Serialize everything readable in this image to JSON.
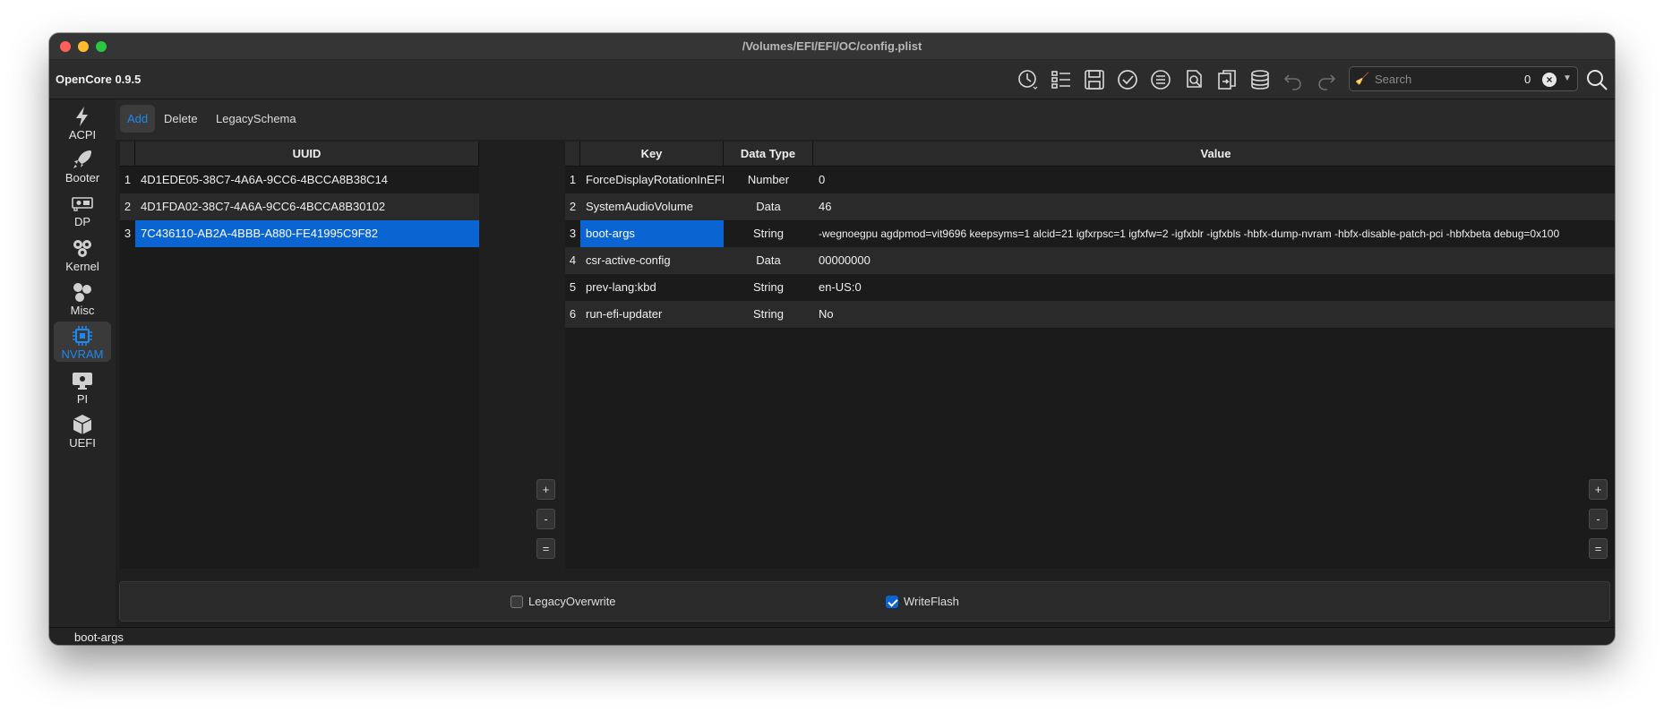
{
  "window": {
    "title": "/Volumes/EFI/EFI/OC/config.plist"
  },
  "app": {
    "title": "OpenCore 0.9.5"
  },
  "toolbar": {
    "icons": [
      "clock-icon",
      "list-icon",
      "save-icon",
      "check-icon",
      "list-check-icon",
      "file-search-icon",
      "file-compare-icon",
      "database-icon",
      "undo-icon",
      "redo-icon"
    ]
  },
  "search": {
    "placeholder": "Search",
    "count": "0"
  },
  "sidebar": {
    "items": [
      {
        "label": "ACPI",
        "icon": "lightning-icon"
      },
      {
        "label": "Booter",
        "icon": "rocket-icon"
      },
      {
        "label": "DP",
        "icon": "gpu-icon"
      },
      {
        "label": "Kernel",
        "icon": "gears-icon"
      },
      {
        "label": "Misc",
        "icon": "circles-icon"
      },
      {
        "label": "NVRAM",
        "icon": "chip-icon",
        "active": true
      },
      {
        "label": "PI",
        "icon": "monitor-icon"
      },
      {
        "label": "UEFI",
        "icon": "cube-icon"
      }
    ]
  },
  "subtabs": [
    "Add",
    "Delete",
    "LegacySchema"
  ],
  "uuid_table": {
    "header": "UUID",
    "rows": [
      {
        "num": "1",
        "uuid": "4D1EDE05-38C7-4A6A-9CC6-4BCCA8B38C14"
      },
      {
        "num": "2",
        "uuid": "4D1FDA02-38C7-4A6A-9CC6-4BCCA8B30102"
      },
      {
        "num": "3",
        "uuid": "7C436110-AB2A-4BBB-A880-FE41995C9F82"
      }
    ]
  },
  "kv_table": {
    "headers": {
      "key": "Key",
      "type": "Data Type",
      "value": "Value"
    },
    "rows": [
      {
        "num": "1",
        "key": "ForceDisplayRotationInEFI",
        "type": "Number",
        "value": "0"
      },
      {
        "num": "2",
        "key": "SystemAudioVolume",
        "type": "Data",
        "value": "46"
      },
      {
        "num": "3",
        "key": "boot-args",
        "type": "String",
        "value": "-wegnoegpu agdpmod=vit9696 keepsyms=1 alcid=21 igfxrpsc=1 igfxfw=2 -igfxblr -igfxbls -hbfx-dump-nvram -hbfx-disable-patch-pci -hbfxbeta debug=0x100"
      },
      {
        "num": "4",
        "key": "csr-active-config",
        "type": "Data",
        "value": "00000000"
      },
      {
        "num": "5",
        "key": "prev-lang:kbd",
        "type": "String",
        "value": "en-US:0"
      },
      {
        "num": "6",
        "key": "run-efi-updater",
        "type": "String",
        "value": "No"
      }
    ]
  },
  "buttons": {
    "add": "+",
    "remove": "-",
    "equal": "="
  },
  "options": {
    "legacy_overwrite": "LegacyOverwrite",
    "write_flash": "WriteFlash"
  },
  "status": {
    "text": "boot-args"
  },
  "colors": {
    "accent": "#0a64d2",
    "active_label": "#1e88f0"
  }
}
